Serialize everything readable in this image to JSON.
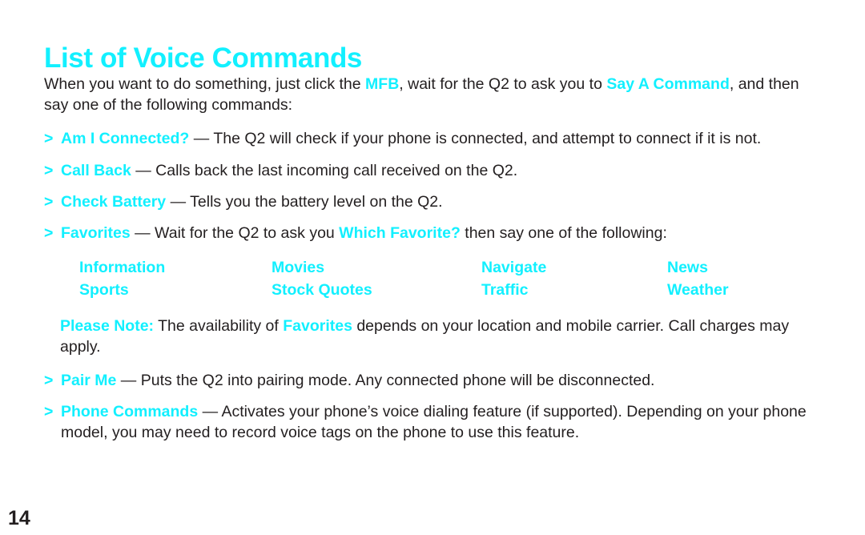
{
  "page": {
    "title": "List of Voice Commands",
    "number": "14",
    "accent_color": "#12f0ff",
    "text_color": "#231f20",
    "background_color": "#ffffff"
  },
  "intro": {
    "part1": "When you want to do something, just click the ",
    "highlight1": "MFB",
    "part2": ", wait for the Q2 to ask you to ",
    "highlight2": "Say A Command",
    "part3": ", and then say one of the following commands:"
  },
  "bullets": [
    {
      "marker": ">",
      "term": "Am I Connected?",
      "dash": "—",
      "description": "The Q2 will check if your phone is connected, and attempt to connect if it is not."
    },
    {
      "marker": ">",
      "term": "Call Back",
      "dash": "—",
      "description": "Calls back the last incoming call received on the Q2."
    },
    {
      "marker": ">",
      "term": "Check Battery",
      "dash": "—",
      "description": "Tells you the battery level on the Q2."
    }
  ],
  "favorites_bullet": {
    "marker": ">",
    "term": "Favorites",
    "dash": "—",
    "pre": "Wait for the Q2 to ask you ",
    "highlight": "Which Favorite?",
    "post": " then say one of the following:"
  },
  "favorites_grid": {
    "row1": [
      "Information",
      "Movies",
      "Navigate",
      "News"
    ],
    "row2": [
      "Sports",
      "Stock Quotes",
      "Traffic",
      "Weather"
    ]
  },
  "note": {
    "label": "Please Note:",
    "part1": " The availability of ",
    "highlight": "Favorites",
    "part2": " depends on your location and mobile carrier. Call charges may apply."
  },
  "bullets_end": [
    {
      "marker": ">",
      "term": "Pair Me",
      "dash": "—",
      "description": "Puts the Q2 into pairing mode. Any connected phone will be disconnected."
    },
    {
      "marker": ">",
      "term": "Phone Commands",
      "dash": "—",
      "description": "Activates your phone’s voice dialing feature (if supported). Depending on your phone model, you may need to record voice tags on the phone to use this feature."
    }
  ]
}
